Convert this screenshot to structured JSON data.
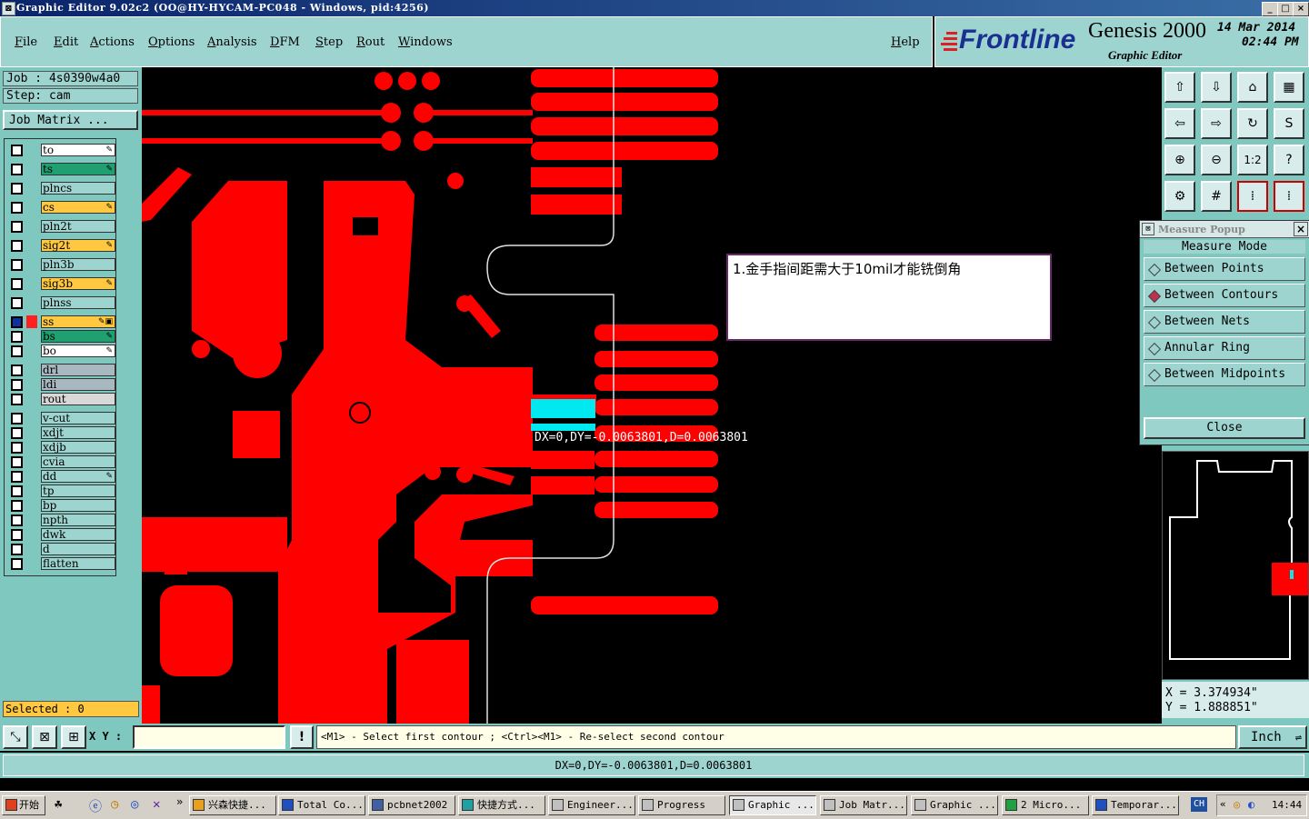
{
  "window": {
    "title": "Graphic Editor 9.02c2 (OO@HY-HYCAM-PC048 - Windows, pid:4256)",
    "controls": [
      "_",
      "□",
      "×"
    ]
  },
  "menu": {
    "items": [
      "File",
      "Edit",
      "Actions",
      "Options",
      "Analysis",
      "DFM",
      "Step",
      "Rout",
      "Windows"
    ],
    "help": "Help"
  },
  "brand": {
    "logo": "Frontline",
    "product": "Genesis 2000",
    "subtitle": "Graphic Editor",
    "date": "14 Mar 2014",
    "time": "02:44 PM"
  },
  "job": {
    "job_label": "Job  : 4s0390w4a0",
    "step_label": "Step: cam",
    "matrix_button": "Job Matrix ..."
  },
  "layers": [
    {
      "name": "to",
      "color": "#ffffff",
      "flag": "✎"
    },
    {
      "name": "ts",
      "color": "#20a070",
      "flag": "✎"
    },
    {
      "name": "plncs",
      "color": "#9ed4d0",
      "flag": ""
    },
    {
      "name": "cs",
      "color": "#ffc840",
      "flag": "✎"
    },
    {
      "name": "pln2t",
      "color": "#9ed4d0",
      "flag": ""
    },
    {
      "name": "sig2t",
      "color": "#ffc840",
      "flag": "✎"
    },
    {
      "name": "pln3b",
      "color": "#9ed4d0",
      "flag": ""
    },
    {
      "name": "sig3b",
      "color": "#ffc840",
      "flag": "✎"
    },
    {
      "name": "plnss",
      "color": "#9ed4d0",
      "flag": ""
    },
    {
      "name": "ss",
      "color": "#ffc840",
      "flag": "✎▣"
    },
    {
      "name": "bs",
      "color": "#20a070",
      "flag": "✎"
    },
    {
      "name": "bo",
      "color": "#ffffff",
      "flag": "✎"
    },
    {
      "name": "drl",
      "color": "#a8b8c0",
      "flag": ""
    },
    {
      "name": "ldi",
      "color": "#a8b8c0",
      "flag": ""
    },
    {
      "name": "rout",
      "color": "#d8d8d8",
      "flag": ""
    },
    {
      "name": "v-cut",
      "color": "#9ed4d0",
      "flag": ""
    },
    {
      "name": "xdjt",
      "color": "#9ed4d0",
      "flag": ""
    },
    {
      "name": "xdjb",
      "color": "#9ed4d0",
      "flag": ""
    },
    {
      "name": "cvia",
      "color": "#9ed4d0",
      "flag": ""
    },
    {
      "name": "dd",
      "color": "#9ed4d0",
      "flag": "✎"
    },
    {
      "name": "tp",
      "color": "#9ed4d0",
      "flag": ""
    },
    {
      "name": "bp",
      "color": "#9ed4d0",
      "flag": ""
    },
    {
      "name": "npth",
      "color": "#9ed4d0",
      "flag": ""
    },
    {
      "name": "dwk",
      "color": "#9ed4d0",
      "flag": ""
    },
    {
      "name": "d",
      "color": "#9ed4d0",
      "flag": ""
    },
    {
      "name": "flatten",
      "color": "#9ed4d0",
      "flag": ""
    }
  ],
  "selected": "Selected : 0",
  "canvas": {
    "note": "1.金手指间距需大于10mil才能铣倒角",
    "measure_readout": "DX=0,DY=-0.0063801,D=0.0063801"
  },
  "measure_popup": {
    "title": "Measure Popup",
    "heading": "Measure Mode",
    "options": [
      "Between Points",
      "Between Contours",
      "Between Nets",
      "Annular Ring",
      "Between Midpoints"
    ],
    "selected": "Between Contours",
    "close": "Close"
  },
  "coords": {
    "x": "X  =  3.374934\"",
    "y": "Y  =  1.888851\""
  },
  "command": {
    "xy_label": "X Y :",
    "input_value": "",
    "prompt": "<M1> - Select first contour ; <Ctrl><M1> - Re-select second contour",
    "units": "Inch"
  },
  "status": "DX=0,DY=-0.0063801,D=0.0063801",
  "taskbar": {
    "start": "开始",
    "items": [
      "兴森快捷...",
      "Total Co...",
      "pcbnet2002",
      "快捷方式...",
      "Engineer...",
      "Progress",
      "Graphic ...",
      "Job Matr...",
      "Graphic ...",
      "2 Micro...",
      "Temporar..."
    ],
    "active": "Graphic ...",
    "ime": "CH",
    "clock": "14:44"
  },
  "colors": {
    "panel": "#7fc8c0",
    "panel_light": "#9ed4d0",
    "copper": "#ff0000",
    "highlight": "#00e8f0"
  }
}
